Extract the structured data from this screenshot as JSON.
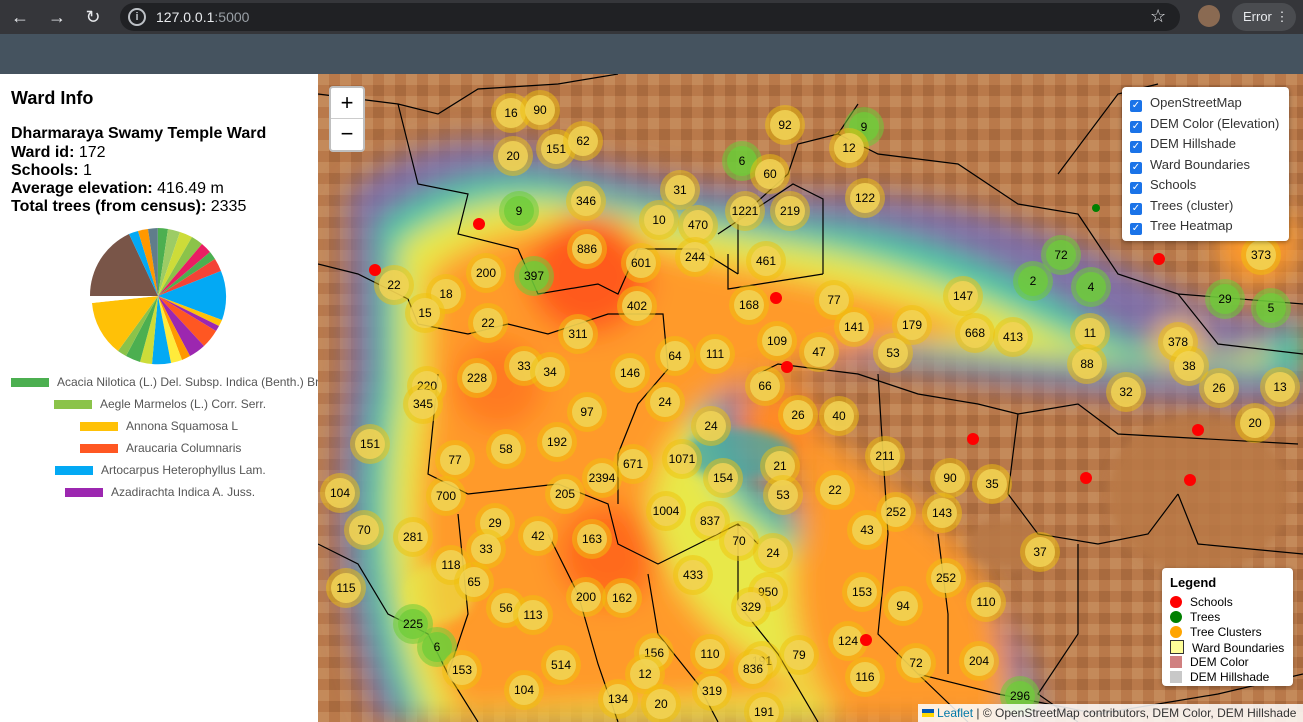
{
  "browser": {
    "url_host": "127.0.0.1",
    "url_port": ":5000",
    "profile_status": "Error"
  },
  "sidebar": {
    "title": "Ward Info",
    "ward_name": "Dharmaraya Swamy Temple Ward",
    "ward_id_label": "Ward id:",
    "ward_id": "172",
    "schools_label": "Schools:",
    "schools": "1",
    "elevation_label": "Average elevation:",
    "elevation": "416.49 m",
    "trees_label": "Total trees (from census):",
    "trees": "2335",
    "species_legend": [
      {
        "name": "Acacia Nilotica (L.) Del. Subsp. Indica (Benth.) Bre",
        "color": "#4caf50"
      },
      {
        "name": "Aegle Marmelos (L.) Corr. Serr.",
        "color": "#8bc34a"
      },
      {
        "name": "Annona Squamosa L",
        "color": "#ffc107"
      },
      {
        "name": "Araucaria Columnaris",
        "color": "#ff5722"
      },
      {
        "name": "Artocarpus Heterophyllus Lam.",
        "color": "#03a9f4"
      },
      {
        "name": "Azadirachta Indica A. Juss.",
        "color": "#9c27b0"
      }
    ]
  },
  "map": {
    "zoom_in": "+",
    "zoom_out": "−",
    "layers": [
      {
        "label": "OpenStreetMap",
        "checked": true
      },
      {
        "label": "DEM Color (Elevation)",
        "checked": true
      },
      {
        "label": "DEM Hillshade",
        "checked": true
      },
      {
        "label": "Ward Boundaries",
        "checked": true
      },
      {
        "label": "Schools",
        "checked": true
      },
      {
        "label": "Trees (cluster)",
        "checked": true
      },
      {
        "label": "Tree Heatmap",
        "checked": true
      }
    ],
    "legend": {
      "title": "Legend",
      "items": [
        {
          "label": "Schools",
          "color": "#ff0000"
        },
        {
          "label": "Trees",
          "color": "#008000"
        },
        {
          "label": "Tree Clusters",
          "color": "#ffa500"
        },
        {
          "label": "Ward Boundaries",
          "color": "#ffff99"
        },
        {
          "label": "DEM Color",
          "color": "#d08080"
        },
        {
          "label": "DEM Hillshade",
          "color": "#c8c8c8"
        }
      ]
    },
    "attribution": {
      "leaflet": "Leaflet",
      "rest": " | © OpenStreetMap contributors, DEM Color, DEM Hillshade"
    },
    "cluster_counts": [
      "16",
      "90",
      "20",
      "151",
      "62",
      "92",
      "9",
      "12",
      "6",
      "60",
      "346",
      "31",
      "9",
      "10",
      "470",
      "1221",
      "219",
      "122",
      "886",
      "601",
      "244",
      "461",
      "200",
      "397",
      "22",
      "18",
      "15",
      "22",
      "402",
      "168",
      "77",
      "147",
      "668",
      "413",
      "311",
      "109",
      "47",
      "141",
      "179",
      "53",
      "64",
      "111",
      "33",
      "34",
      "146",
      "228",
      "220",
      "345",
      "66",
      "26",
      "40",
      "97",
      "24",
      "24",
      "151",
      "77",
      "58",
      "192",
      "671",
      "1071",
      "211",
      "2394",
      "21",
      "154",
      "53",
      "22",
      "90",
      "35",
      "104",
      "700",
      "205",
      "1004",
      "837",
      "29",
      "42",
      "163",
      "70",
      "24",
      "43",
      "252",
      "143",
      "70",
      "281",
      "33",
      "118",
      "65",
      "433",
      "950",
      "200",
      "162",
      "56",
      "113",
      "329",
      "153",
      "94",
      "252",
      "110",
      "115",
      "225",
      "6",
      "153",
      "156",
      "110",
      "191",
      "124",
      "79",
      "72",
      "204",
      "514",
      "12",
      "836",
      "104",
      "134",
      "319",
      "20",
      "191",
      "116",
      "296",
      "72",
      "2",
      "4",
      "373",
      "29",
      "5",
      "11",
      "378",
      "38",
      "26",
      "13",
      "88",
      "32",
      "20",
      "37"
    ],
    "school_count_visible": 10
  }
}
